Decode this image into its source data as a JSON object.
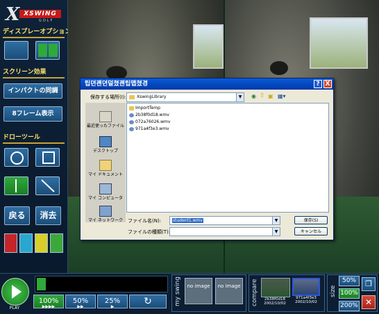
{
  "logo": {
    "text": "XSWING",
    "sub": "GOLF"
  },
  "sidebar": {
    "display_title": "ディスプレーオプション",
    "screen_title": "スクリーン効果",
    "impact_label": "インパクトの同調",
    "frames_label": "8フレーム表示",
    "draw_title": "ドローツール",
    "back_label": "戻る",
    "erase_label": "消去",
    "colors": [
      "#c4252a",
      "#2aa7cf",
      "#d8cf2a",
      "#3da83a"
    ]
  },
  "dialog": {
    "title": "팁뎐괜뎐덜쳤괜팁맵쳤경",
    "save_in_label": "保存する場所(I):",
    "save_in_value": "XswingLibrary",
    "places": [
      "最近使ったファイル",
      "デスクトップ",
      "マイ ドキュメント",
      "マイ コンピュータ",
      "マイ ネットワーク"
    ],
    "files": [
      "ImportTemp",
      "2b38f0d18.wmv",
      "072a76026.wmv",
      "971a4f3e3.wmv"
    ],
    "filename_label": "ファイル名(N):",
    "filename_value": "student1.wmv",
    "filetype_label": "ファイルの種類(T):",
    "filetype_value": "",
    "save_button": "保存(S)",
    "cancel_button": "キャンセル",
    "help_glyph": "?",
    "close_glyph": "X"
  },
  "bottom": {
    "play_label": "PLAY",
    "speeds": [
      "100%",
      "50%",
      "25%"
    ],
    "my_swing_label": "my swing",
    "no_image_1": "no image",
    "no_image_2": "no image",
    "compare_label": "compare",
    "thumb1": {
      "id": "2b38f0d18",
      "date": "2002/10/02"
    },
    "thumb2": {
      "id": "971a4f3e3",
      "date": "2002/10/02"
    },
    "size_label": "size",
    "sizes": [
      "50%",
      "100%",
      "200%"
    ],
    "progress": 0.07
  }
}
